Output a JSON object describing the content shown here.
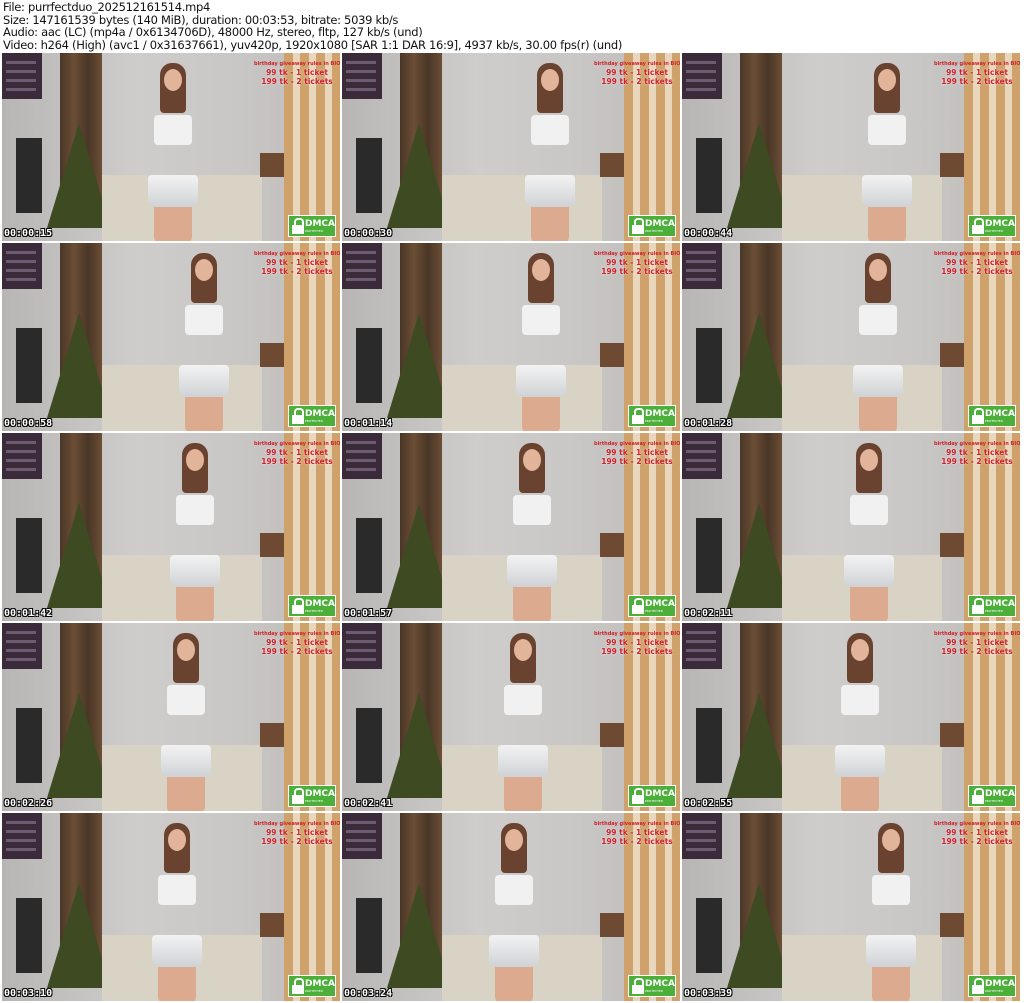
{
  "header": {
    "file": "File: purrfectduo_202512161514.mp4",
    "size": "Size: 147161539 bytes (140 MiB), duration: 00:03:53, bitrate: 5039 kb/s",
    "audio": "Audio: aac (LC) (mp4a / 0x6134706D), 48000 Hz, stereo, fltp, 127 kb/s (und)",
    "video": "Video: h264 (High) (avc1 / 0x31637661), yuv420p, 1920x1080 [SAR 1:1 DAR 16:9], 4937 kb/s, 30.00 fps(r) (und)"
  },
  "overlay": {
    "line1": "birthday giveaway rules in BIO",
    "line2": "99 tk - 1 ticket",
    "line3": "199 tk - 2 tickets"
  },
  "dmca": {
    "label": "DMCA",
    "sub": "PROTECTED"
  },
  "thumbnails": [
    {
      "timestamp": "00:00:15"
    },
    {
      "timestamp": "00:00:30"
    },
    {
      "timestamp": "00:00:44"
    },
    {
      "timestamp": "00:00:58"
    },
    {
      "timestamp": "00:01:14"
    },
    {
      "timestamp": "00:01:28"
    },
    {
      "timestamp": "00:01:42"
    },
    {
      "timestamp": "00:01:57"
    },
    {
      "timestamp": "00:02:11"
    },
    {
      "timestamp": "00:02:26"
    },
    {
      "timestamp": "00:02:41"
    },
    {
      "timestamp": "00:02:55"
    },
    {
      "timestamp": "00:03:10"
    },
    {
      "timestamp": "00:03:24"
    },
    {
      "timestamp": "00:03:39"
    }
  ]
}
